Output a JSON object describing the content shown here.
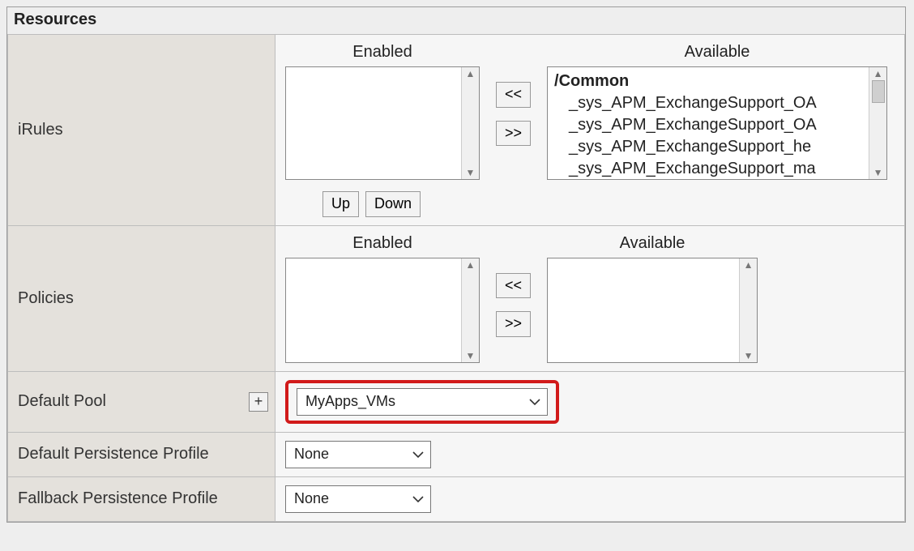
{
  "section_title": "Resources",
  "headings": {
    "enabled": "Enabled",
    "available": "Available"
  },
  "buttons": {
    "move_left": "<<",
    "move_right": ">>",
    "up": "Up",
    "down": "Down",
    "plus": "+"
  },
  "rows": {
    "irules": {
      "label": "iRules",
      "enabled_items": [],
      "available_group": "/Common",
      "available_items": [
        "_sys_APM_ExchangeSupport_OA",
        "_sys_APM_ExchangeSupport_OA",
        "_sys_APM_ExchangeSupport_he",
        "_sys_APM_ExchangeSupport_ma"
      ]
    },
    "policies": {
      "label": "Policies",
      "enabled_items": [],
      "available_items": []
    },
    "default_pool": {
      "label": "Default Pool",
      "value": "MyApps_VMs"
    },
    "default_persistence": {
      "label": "Default Persistence Profile",
      "value": "None"
    },
    "fallback_persistence": {
      "label": "Fallback Persistence Profile",
      "value": "None"
    }
  }
}
